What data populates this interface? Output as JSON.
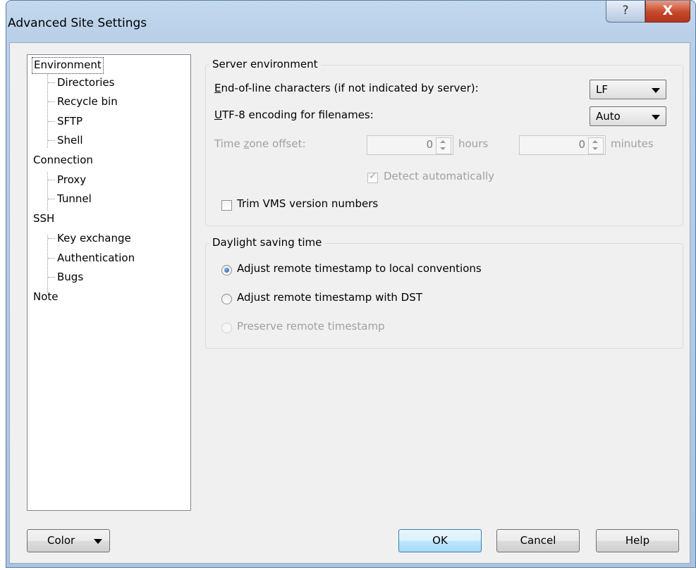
{
  "window": {
    "title": "Advanced Site Settings",
    "help_glyph": "?",
    "close_glyph": "X"
  },
  "tree": [
    {
      "label": "Environment",
      "level": 0,
      "selected": true
    },
    {
      "label": "Directories",
      "level": 1
    },
    {
      "label": "Recycle bin",
      "level": 1
    },
    {
      "label": "SFTP",
      "level": 1
    },
    {
      "label": "Shell",
      "level": 1
    },
    {
      "label": "Connection",
      "level": 0
    },
    {
      "label": "Proxy",
      "level": 1
    },
    {
      "label": "Tunnel",
      "level": 1
    },
    {
      "label": "SSH",
      "level": 0
    },
    {
      "label": "Key exchange",
      "level": 1
    },
    {
      "label": "Authentication",
      "level": 1
    },
    {
      "label": "Bugs",
      "level": 1
    },
    {
      "label": "Note",
      "level": 0
    }
  ],
  "server_env": {
    "title": "Server environment",
    "eol_label": "End-of-line characters (if not indicated by server):",
    "eol_value": "LF",
    "utf8_label": "UTF-8 encoding for filenames:",
    "utf8_value": "Auto",
    "tz_label": "Time zone offset:",
    "tz_hours_value": "0",
    "tz_hours_unit": "hours",
    "tz_minutes_value": "0",
    "tz_minutes_unit": "minutes",
    "detect_label": "Detect automatically",
    "detect_checked": true,
    "trim_label": "Trim VMS version numbers",
    "trim_checked": false
  },
  "dst": {
    "title": "Daylight saving time",
    "options": [
      {
        "label": "Adjust remote timestamp to local conventions",
        "selected": true,
        "enabled": true
      },
      {
        "label": "Adjust remote timestamp with DST",
        "selected": false,
        "enabled": true
      },
      {
        "label": "Preserve remote timestamp",
        "selected": false,
        "enabled": false
      }
    ]
  },
  "buttons": {
    "color": "Color",
    "ok": "OK",
    "cancel": "Cancel",
    "help": "Help"
  }
}
